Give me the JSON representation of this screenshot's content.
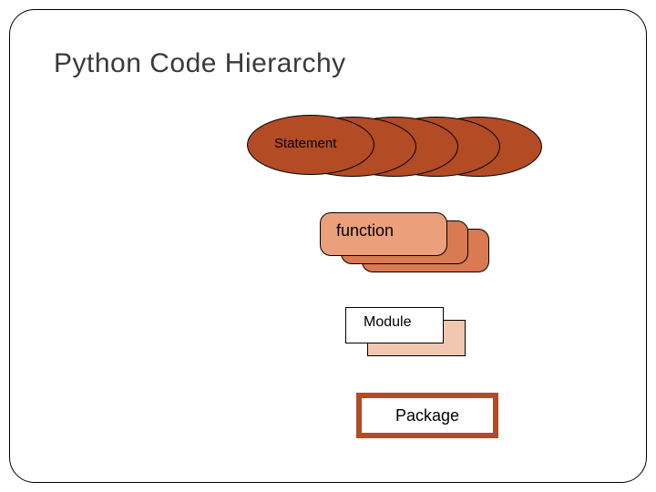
{
  "title": "Python Code Hierarchy",
  "levels": {
    "statement": {
      "label": "Statement",
      "count": 5
    },
    "function": {
      "label": "function",
      "count": 3
    },
    "module": {
      "label": "Module",
      "count": 2
    },
    "package": {
      "label": "Package",
      "count": 1
    }
  },
  "colors": {
    "statement_fill": "#b34b24",
    "function_fill_back": "#d97a53",
    "function_fill_front": "#eaa07b",
    "module_fill_back": "#f0c7b0",
    "module_fill_front": "#ffffff",
    "package_border": "#b34b24"
  }
}
